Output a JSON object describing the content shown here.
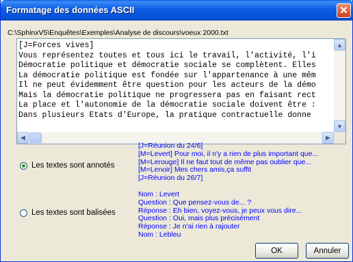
{
  "window": {
    "title": "Formatage des données ASCII",
    "close_glyph": "✕",
    "file_path": "C:\\SphinxV5\\Enquêtes\\Exemples\\Analyse de discours\\voeux 2000.txt"
  },
  "text_preview": {
    "lines": [
      "[J=Forces vives]",
      "Vous représentez toutes et tous ici le travail, l'activité, l'i",
      "Démocratie politique et démocratie sociale se complètent. Elles",
      "La démocratie politique est fondée sur l'appartenance à une mêm",
      "Il ne peut évidemment être question pour les acteurs de la démo",
      "Mais la démocratie politique ne progressera pas en faisant rect",
      "La place et l'autonomie de la démocratie sociale doivent être :",
      "Dans plusieurs Etats d'Europe, la pratique contractuelle donne"
    ]
  },
  "options": {
    "annotated": {
      "label": "Les textes sont annotés",
      "selected": true,
      "example": [
        "[J=Réunion du 24/6]",
        "[M=Levert] Pour moi, il n'y a rien de plus important que...",
        "[M=Lerouge] Il ne faut tout de même pas oublier que...",
        "[M=Lenoir] Mes chers amis,ça suffit",
        "[J=Réunion du 26/7]"
      ]
    },
    "tagged": {
      "label": "Les textes sont balisées",
      "selected": false,
      "example": [
        "Nom : Levert",
        "Question : Que pensez-vous de... ?",
        "Réponse : Eh bien, voyez-vous, je peux vous dire...",
        "Question : Oui, mais plus précisément",
        "Réponse : Je n'ai rien à rajouter",
        "Nom : Lebleu"
      ]
    }
  },
  "buttons": {
    "ok": "OK",
    "cancel": "Annuler"
  }
}
